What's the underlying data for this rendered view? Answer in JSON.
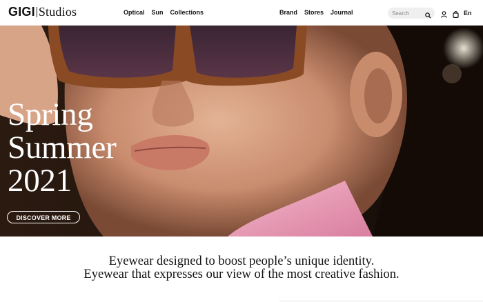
{
  "logo": {
    "part1": "GIGI",
    "part2": "Studios"
  },
  "nav_left": [
    "Optical",
    "Sun",
    "Collections"
  ],
  "nav_right": [
    "Brand",
    "Stores",
    "Journal"
  ],
  "search": {
    "placeholder": "Search"
  },
  "language": "En",
  "icons": {
    "search": "search-icon",
    "account": "user-icon",
    "bag": "shopping-bag-icon"
  },
  "hero": {
    "headline": [
      "Spring",
      "Summer",
      "2021"
    ],
    "cta_label": "DISCOVER MORE"
  },
  "tagline": [
    "Eyewear designed to boost people’s unique identity.",
    "Eyewear that expresses our view of the most creative fashion."
  ],
  "colors": {
    "hero_bg": "#1b0f09",
    "text": "#111111",
    "white": "#ffffff",
    "search_bg": "#efefef"
  }
}
